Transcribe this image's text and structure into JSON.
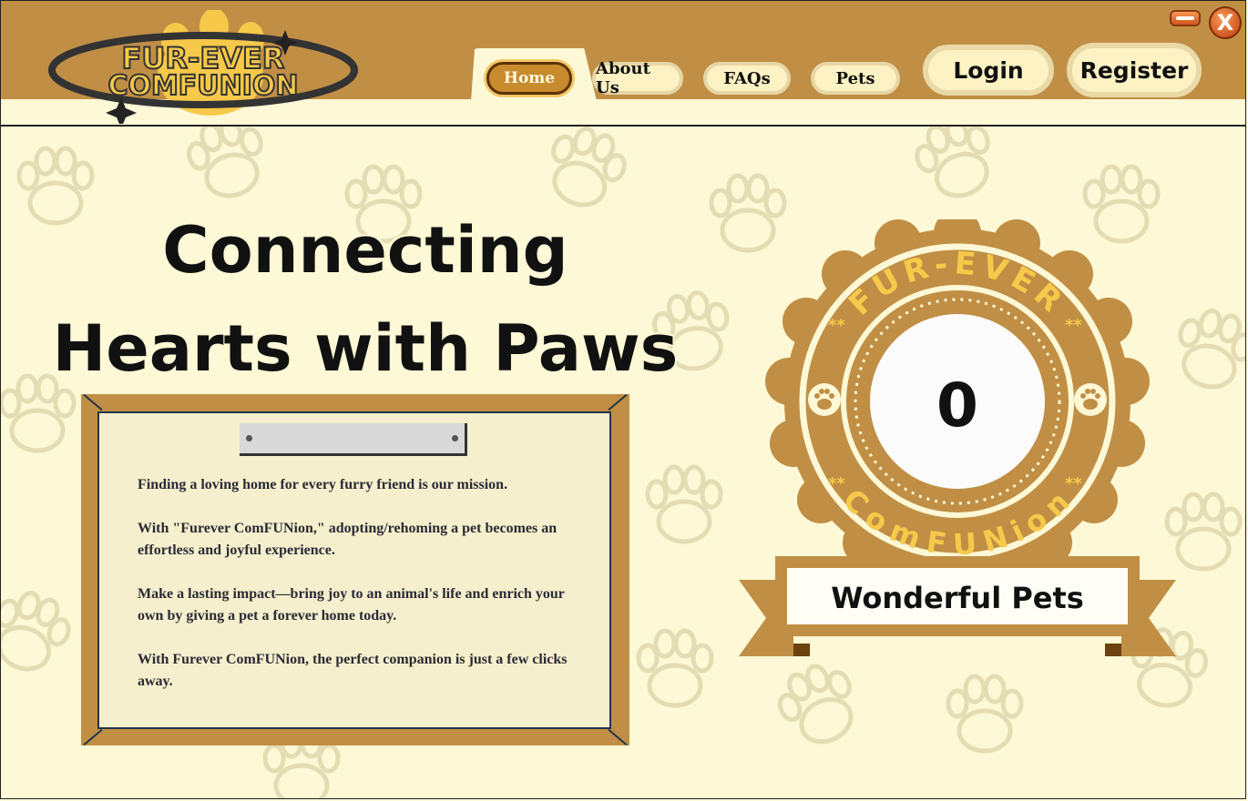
{
  "window": {
    "minimize_icon": "minimize-icon",
    "close_label": "X"
  },
  "header": {
    "logo_line1": "FUR-EVER",
    "logo_line2": "COMFUNION",
    "nav": [
      {
        "label": "Home",
        "active": true
      },
      {
        "label": "About Us",
        "active": false
      },
      {
        "label": "FAQs",
        "active": false
      },
      {
        "label": "Pets",
        "active": false
      }
    ],
    "login_label": "Login",
    "register_label": "Register"
  },
  "hero": {
    "line1": "Connecting",
    "line2": "Hearts with Paws"
  },
  "board": {
    "paragraphs": [
      "Finding a loving home for every furry friend is our mission.",
      "With \"Furever ComFUNion,\" adopting/rehoming a pet becomes an effortless and joyful experience.",
      "Make a lasting impact—bring joy to an animal's life and enrich your own by giving a pet a forever home today.",
      "With Furever ComFUNion, the perfect companion is just a few clicks away."
    ]
  },
  "badge": {
    "top_text": "FUR-EVER",
    "bottom_text": "ComFUNion",
    "count": "0",
    "label": "Wonderful Pets"
  },
  "colors": {
    "brand_brown": "#c08f45",
    "cream": "#fdf8d6",
    "gold": "#f6c94a",
    "dark": "#111111"
  }
}
